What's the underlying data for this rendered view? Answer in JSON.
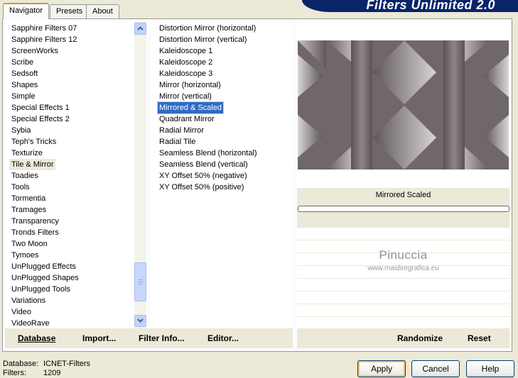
{
  "banner": {
    "title": "Filters Unlimited 2.0"
  },
  "tabs": [
    {
      "label": "Navigator",
      "active": true
    },
    {
      "label": "Presets",
      "active": false
    },
    {
      "label": "About",
      "active": false
    }
  ],
  "categories": [
    "Sapphire Filters 07",
    "Sapphire Filters 12",
    "ScreenWorks",
    "Scribe",
    "Sedsoft",
    "Shapes",
    "Simple",
    "Special Effects 1",
    "Special Effects 2",
    "Sybia",
    "Teph's Tricks",
    "Texturize",
    "Tile & Mirror",
    "Toadies",
    "Tools",
    "Tormentia",
    "Tramages",
    "Transparency",
    "Tronds Filters",
    "Two Moon",
    "Tymoes",
    "UnPlugged Effects",
    "UnPlugged Shapes",
    "UnPlugged Tools",
    "Variations",
    "Video",
    "VideoRave"
  ],
  "selected_category": "Tile & Mirror",
  "filters": [
    "Distortion Mirror (horizontal)",
    "Distortion Mirror (vertical)",
    "Kaleidoscope 1",
    "Kaleidoscope 2",
    "Kaleidoscope 3",
    "Mirror (horizontal)",
    "Mirror (vertical)",
    "Mirrored & Scaled",
    "Quadrant Mirror",
    "Radial Mirror",
    "Radial Tile",
    "Seamless Blend (horizontal)",
    "Seamless Blend (vertical)",
    "XY Offset 50% (negative)",
    "XY Offset 50% (positive)"
  ],
  "selected_filter": "Mirrored & Scaled",
  "preview": {
    "filter_name": "Mirrored  Scaled"
  },
  "watermark": {
    "name": "Pinuccia",
    "url": "www.maidiregrafica.eu"
  },
  "buttons_left": {
    "database": "Database",
    "import": "Import...",
    "filter_info": "Filter Info...",
    "editor": "Editor..."
  },
  "buttons_right": {
    "randomize": "Randomize",
    "reset": "Reset"
  },
  "status": {
    "database_label": "Database:",
    "database_value": "ICNET-Filters",
    "filters_label": "Filters:",
    "filters_value": "1209"
  },
  "dialog_buttons": {
    "apply": "Apply",
    "cancel": "Cancel",
    "help": "Help"
  },
  "colors": {
    "selection": "#316ac5",
    "banner": "#0a246a",
    "window_bg": "#ece9d8"
  },
  "icons": {
    "scroll_up": "chevron-up-icon",
    "scroll_down": "chevron-down-icon"
  }
}
